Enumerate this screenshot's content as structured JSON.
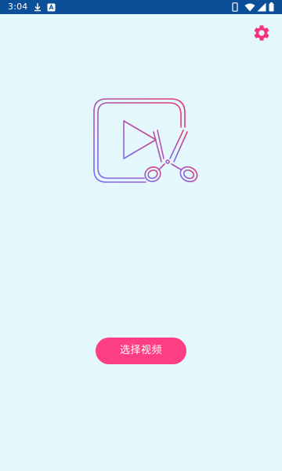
{
  "status_bar": {
    "time": "3:04",
    "background_color": "#0b4f98",
    "left_icons": [
      "download-icon",
      "app-notification-icon"
    ],
    "right_icons": [
      "phone-icon",
      "wifi-icon",
      "signal-icon",
      "battery-icon"
    ]
  },
  "toolbar": {
    "settings_icon": "gear-icon",
    "accent_color": "#f4327d"
  },
  "hero": {
    "logo_icon": "video-cut-icon",
    "gradient_colors": [
      "#e43a6c",
      "#7b6cf0"
    ]
  },
  "main": {
    "select_video_label": "选择视频",
    "button_color": "#fd3e82"
  },
  "page": {
    "background_color": "#e4f7fd"
  }
}
